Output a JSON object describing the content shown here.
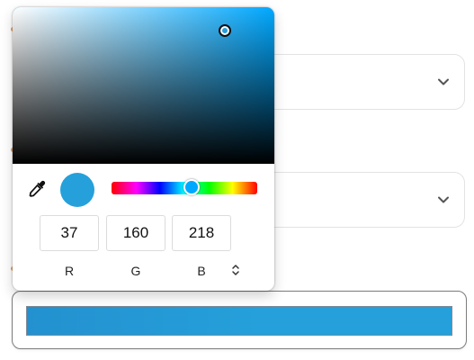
{
  "picker": {
    "color_hex": "#25A0DA",
    "hue_color": "#00A8FF",
    "hue_fraction": 0.55,
    "rgb": {
      "r": "37",
      "g": "160",
      "b": "218"
    },
    "labels": {
      "r": "R",
      "g": "G",
      "b": "B"
    }
  },
  "icons": {
    "eyedropper": "eyedropper-icon",
    "mode_toggle": "chevron-up-down-icon",
    "select_chevron": "chevron-down-icon"
  },
  "colors": {
    "field_swatch": "#25A0DA",
    "label_dot": "#E6A26A"
  }
}
